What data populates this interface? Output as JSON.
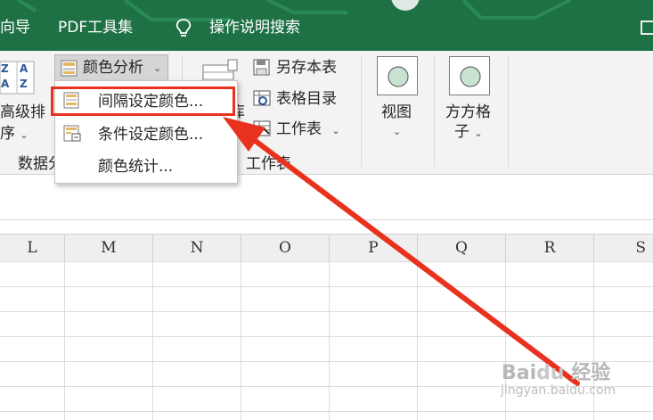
{
  "menu": {
    "item_wizard": "向导",
    "item_pdf": "PDF工具集",
    "item_search": "操作说明搜索"
  },
  "ribbon": {
    "sort_line1": "高级排",
    "sort_line2": "序",
    "sort_letters_a": "Z",
    "sort_letters_b": "A",
    "sort_letters_c": "A",
    "sort_letters_d": "Z",
    "color_analysis": "颜色分析",
    "group_data": "数据分",
    "save_sheet": "另存本表",
    "table_catalog": "表格目录",
    "worksheet": "工作表",
    "group_worksheet": "工作表",
    "partial_label": "库",
    "view_label": "视图",
    "grid_line1": "方方格",
    "grid_line2": "子"
  },
  "dropdown": {
    "items": [
      {
        "label": "间隔设定颜色..."
      },
      {
        "label": "条件设定颜色..."
      },
      {
        "label": "颜色统计..."
      }
    ]
  },
  "columns": [
    "L",
    "M",
    "N",
    "O",
    "P",
    "Q",
    "R",
    "S"
  ],
  "watermark": {
    "brand": "Bai",
    "brand2": "经验",
    "url": "jingyan.baidu.com"
  },
  "colors": {
    "title_bar": "#1e7145",
    "annotation": "#e8321e"
  }
}
